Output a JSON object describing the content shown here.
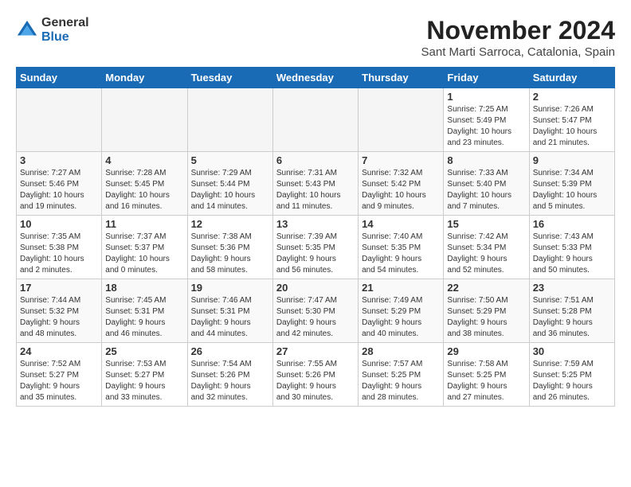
{
  "header": {
    "logo_general": "General",
    "logo_blue": "Blue",
    "month_title": "November 2024",
    "subtitle": "Sant Marti Sarroca, Catalonia, Spain"
  },
  "weekdays": [
    "Sunday",
    "Monday",
    "Tuesday",
    "Wednesday",
    "Thursday",
    "Friday",
    "Saturday"
  ],
  "weeks": [
    [
      {
        "day": "",
        "info": ""
      },
      {
        "day": "",
        "info": ""
      },
      {
        "day": "",
        "info": ""
      },
      {
        "day": "",
        "info": ""
      },
      {
        "day": "",
        "info": ""
      },
      {
        "day": "1",
        "info": "Sunrise: 7:25 AM\nSunset: 5:49 PM\nDaylight: 10 hours\nand 23 minutes."
      },
      {
        "day": "2",
        "info": "Sunrise: 7:26 AM\nSunset: 5:47 PM\nDaylight: 10 hours\nand 21 minutes."
      }
    ],
    [
      {
        "day": "3",
        "info": "Sunrise: 7:27 AM\nSunset: 5:46 PM\nDaylight: 10 hours\nand 19 minutes."
      },
      {
        "day": "4",
        "info": "Sunrise: 7:28 AM\nSunset: 5:45 PM\nDaylight: 10 hours\nand 16 minutes."
      },
      {
        "day": "5",
        "info": "Sunrise: 7:29 AM\nSunset: 5:44 PM\nDaylight: 10 hours\nand 14 minutes."
      },
      {
        "day": "6",
        "info": "Sunrise: 7:31 AM\nSunset: 5:43 PM\nDaylight: 10 hours\nand 11 minutes."
      },
      {
        "day": "7",
        "info": "Sunrise: 7:32 AM\nSunset: 5:42 PM\nDaylight: 10 hours\nand 9 minutes."
      },
      {
        "day": "8",
        "info": "Sunrise: 7:33 AM\nSunset: 5:40 PM\nDaylight: 10 hours\nand 7 minutes."
      },
      {
        "day": "9",
        "info": "Sunrise: 7:34 AM\nSunset: 5:39 PM\nDaylight: 10 hours\nand 5 minutes."
      }
    ],
    [
      {
        "day": "10",
        "info": "Sunrise: 7:35 AM\nSunset: 5:38 PM\nDaylight: 10 hours\nand 2 minutes."
      },
      {
        "day": "11",
        "info": "Sunrise: 7:37 AM\nSunset: 5:37 PM\nDaylight: 10 hours\nand 0 minutes."
      },
      {
        "day": "12",
        "info": "Sunrise: 7:38 AM\nSunset: 5:36 PM\nDaylight: 9 hours\nand 58 minutes."
      },
      {
        "day": "13",
        "info": "Sunrise: 7:39 AM\nSunset: 5:35 PM\nDaylight: 9 hours\nand 56 minutes."
      },
      {
        "day": "14",
        "info": "Sunrise: 7:40 AM\nSunset: 5:35 PM\nDaylight: 9 hours\nand 54 minutes."
      },
      {
        "day": "15",
        "info": "Sunrise: 7:42 AM\nSunset: 5:34 PM\nDaylight: 9 hours\nand 52 minutes."
      },
      {
        "day": "16",
        "info": "Sunrise: 7:43 AM\nSunset: 5:33 PM\nDaylight: 9 hours\nand 50 minutes."
      }
    ],
    [
      {
        "day": "17",
        "info": "Sunrise: 7:44 AM\nSunset: 5:32 PM\nDaylight: 9 hours\nand 48 minutes."
      },
      {
        "day": "18",
        "info": "Sunrise: 7:45 AM\nSunset: 5:31 PM\nDaylight: 9 hours\nand 46 minutes."
      },
      {
        "day": "19",
        "info": "Sunrise: 7:46 AM\nSunset: 5:31 PM\nDaylight: 9 hours\nand 44 minutes."
      },
      {
        "day": "20",
        "info": "Sunrise: 7:47 AM\nSunset: 5:30 PM\nDaylight: 9 hours\nand 42 minutes."
      },
      {
        "day": "21",
        "info": "Sunrise: 7:49 AM\nSunset: 5:29 PM\nDaylight: 9 hours\nand 40 minutes."
      },
      {
        "day": "22",
        "info": "Sunrise: 7:50 AM\nSunset: 5:29 PM\nDaylight: 9 hours\nand 38 minutes."
      },
      {
        "day": "23",
        "info": "Sunrise: 7:51 AM\nSunset: 5:28 PM\nDaylight: 9 hours\nand 36 minutes."
      }
    ],
    [
      {
        "day": "24",
        "info": "Sunrise: 7:52 AM\nSunset: 5:27 PM\nDaylight: 9 hours\nand 35 minutes."
      },
      {
        "day": "25",
        "info": "Sunrise: 7:53 AM\nSunset: 5:27 PM\nDaylight: 9 hours\nand 33 minutes."
      },
      {
        "day": "26",
        "info": "Sunrise: 7:54 AM\nSunset: 5:26 PM\nDaylight: 9 hours\nand 32 minutes."
      },
      {
        "day": "27",
        "info": "Sunrise: 7:55 AM\nSunset: 5:26 PM\nDaylight: 9 hours\nand 30 minutes."
      },
      {
        "day": "28",
        "info": "Sunrise: 7:57 AM\nSunset: 5:25 PM\nDaylight: 9 hours\nand 28 minutes."
      },
      {
        "day": "29",
        "info": "Sunrise: 7:58 AM\nSunset: 5:25 PM\nDaylight: 9 hours\nand 27 minutes."
      },
      {
        "day": "30",
        "info": "Sunrise: 7:59 AM\nSunset: 5:25 PM\nDaylight: 9 hours\nand 26 minutes."
      }
    ]
  ]
}
